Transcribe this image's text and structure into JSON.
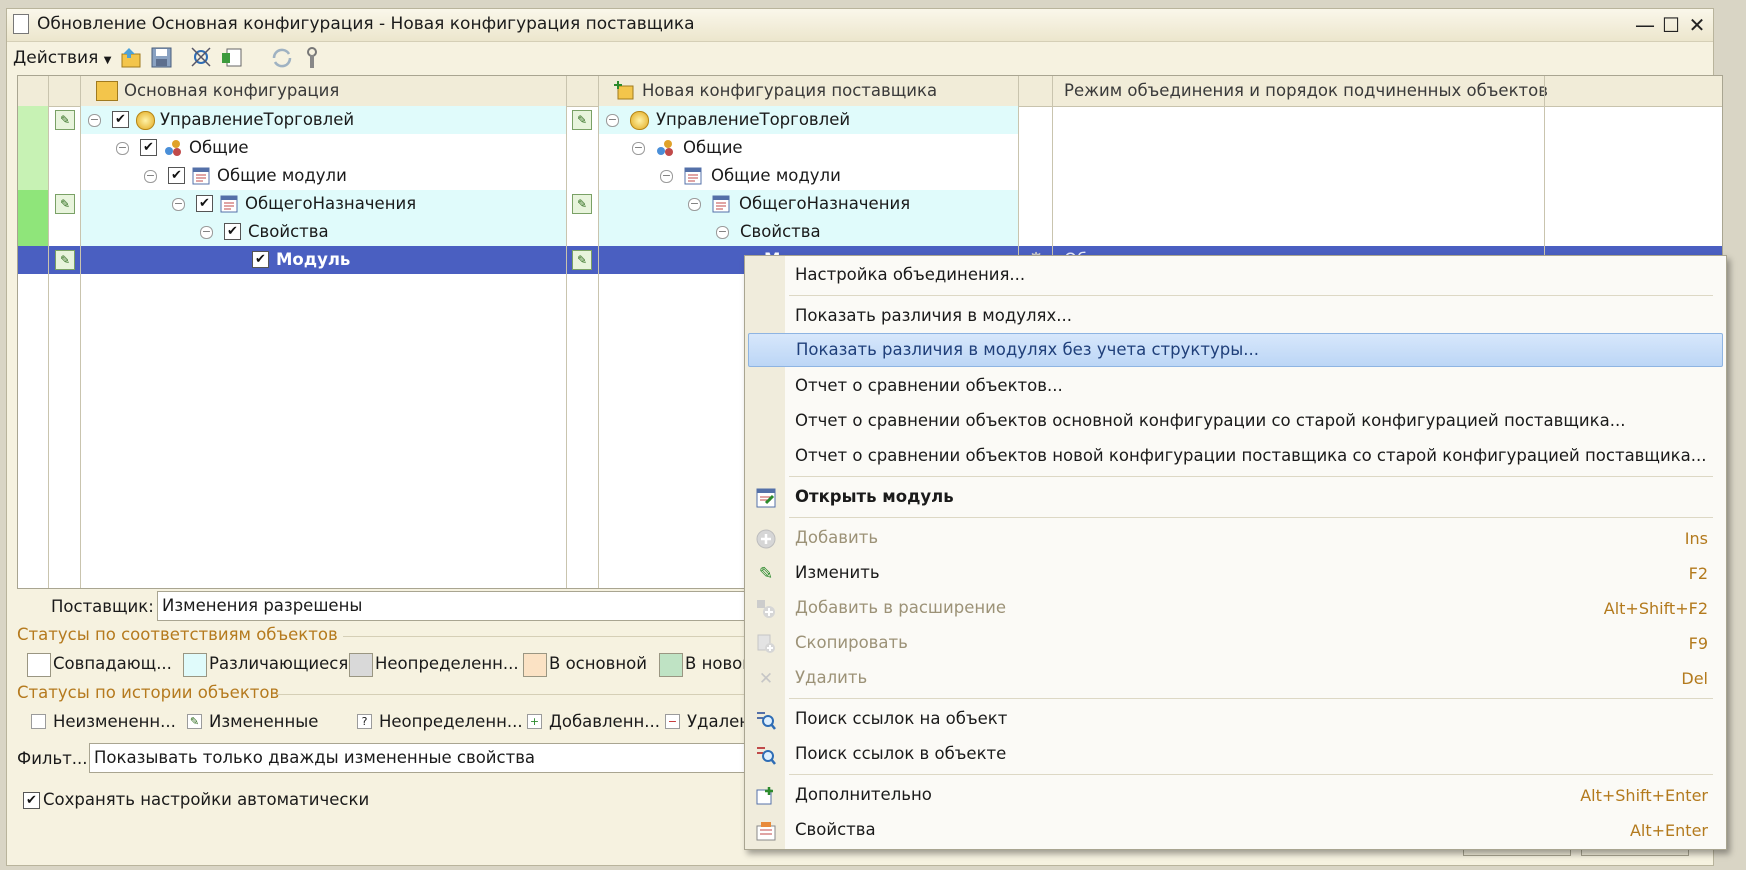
{
  "window": {
    "title": "Обновление Основная конфигурация - Новая конфигурация поставщика",
    "controls": {
      "minimize": "—",
      "maximize": "☐",
      "close": "✕"
    }
  },
  "toolbar": {
    "actions_label": "Действия"
  },
  "grid": {
    "columns": {
      "main": "Основная конфигурация",
      "vendor": "Новая конфигурация поставщика",
      "merge": "Режим объединения и порядок подчиненных объектов"
    },
    "rows": [
      {
        "left": "УправлениеТорговлей",
        "right": "УправлениеТорговлей",
        "merge": ""
      },
      {
        "left": "Общие",
        "right": "Общие",
        "merge": ""
      },
      {
        "left": "Общие модули",
        "right": "Общие модули",
        "merge": ""
      },
      {
        "left": "ОбщегоНазначения",
        "right": "ОбщегоНазначения",
        "merge": ""
      },
      {
        "left": "Свойства",
        "right": "Свойства",
        "merge": ""
      },
      {
        "left": "Модуль",
        "right": "М",
        "merge": "Об"
      }
    ]
  },
  "supplier": {
    "label": "Поставщик:",
    "value": "Изменения разрешены"
  },
  "status_match": {
    "title": "Статусы по соответствиям объектов",
    "items": [
      {
        "label": "Совпадающ...",
        "color": "#ffffff"
      },
      {
        "label": "Различающиеся",
        "color": "#e0fbfb"
      },
      {
        "label": "Неопределенн...",
        "color": "#d9d9d9"
      },
      {
        "label": "В основной",
        "color": "#fbe2c4"
      },
      {
        "label": "В новой",
        "color": "#bfe3c4"
      }
    ]
  },
  "status_history": {
    "title": "Статусы по истории объектов",
    "items": [
      "Неизмененн...",
      "Измененные",
      "Неопределенн...",
      "Добавленн...",
      "Удален"
    ]
  },
  "filter": {
    "label": "Фильт...",
    "value": "Показывать только дважды измененные свойства"
  },
  "autosave": {
    "label": "Сохранять настройки автоматически",
    "checked": true
  },
  "context_menu": {
    "items": [
      {
        "label": "Настройка объединения...",
        "shortcut": ""
      },
      {
        "label": "Показать различия в модулях...",
        "shortcut": ""
      },
      {
        "label": "Показать различия в модулях без учета структуры...",
        "shortcut": ""
      },
      {
        "label": "Отчет о сравнении объектов...",
        "shortcut": ""
      },
      {
        "label": "Отчет о сравнении объектов основной конфигурации со старой конфигурацией поставщика...",
        "shortcut": ""
      },
      {
        "label": "Отчет о сравнении объектов новой конфигурации поставщика со старой конфигурацией поставщика...",
        "shortcut": ""
      },
      {
        "label": "Открыть модуль",
        "shortcut": ""
      },
      {
        "label": "Добавить",
        "shortcut": "Ins"
      },
      {
        "label": "Изменить",
        "shortcut": "F2"
      },
      {
        "label": "Добавить в расширение",
        "shortcut": "Alt+Shift+F2"
      },
      {
        "label": "Скопировать",
        "shortcut": "F9"
      },
      {
        "label": "Удалить",
        "shortcut": "Del"
      },
      {
        "label": "Поиск ссылок на объект",
        "shortcut": ""
      },
      {
        "label": "Поиск ссылок в объекте",
        "shortcut": ""
      },
      {
        "label": "Дополнительно",
        "shortcut": "Alt+Shift+Enter"
      },
      {
        "label": "Свойства",
        "shortcut": "Alt+Enter"
      }
    ]
  },
  "colors": {
    "selection": "#4a5fc1",
    "diff_row": "#e0fbfb",
    "menu_highlight": "#c6dcf8",
    "accent_orange": "#b57a1e"
  }
}
